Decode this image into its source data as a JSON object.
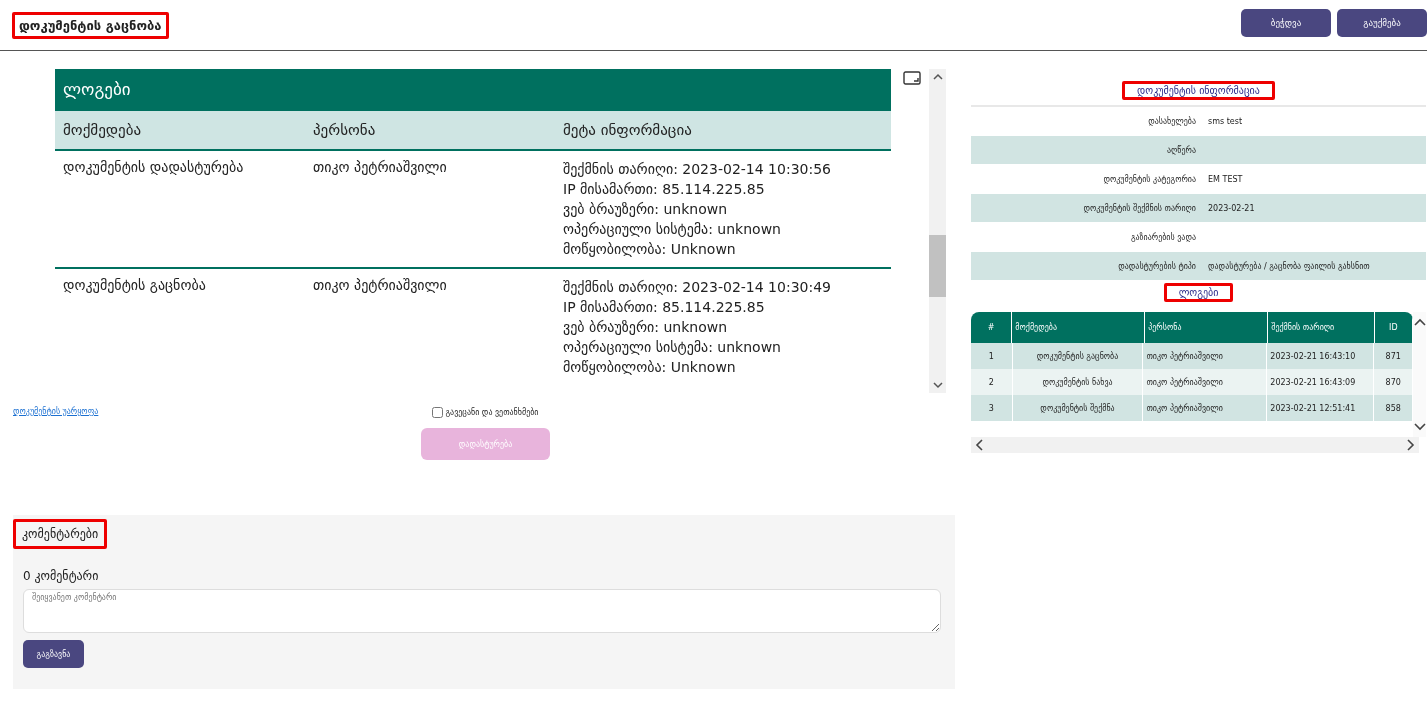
{
  "page_title": "დოკუმენტის გაცნობა",
  "header_buttons": [
    "ბეჭდვა",
    "გაუქმება"
  ],
  "document": {
    "heading": "ლოგები",
    "columns": [
      "მოქმედება",
      "პერსონა",
      "მეტა ინფორმაცია"
    ],
    "rows": [
      {
        "action": "დოკუმენტის დადასტურება",
        "person": "თიკო პეტრიაშვილი",
        "meta": [
          "შექმნის თარიღი: 2023-02-14 10:30:56",
          "IP მისამართი: 85.114.225.85",
          "ვებ ბრაუზერი: unknown",
          "ოპერაციული სისტემა: unknown",
          "მოწყობილობა: Unknown"
        ]
      },
      {
        "action": "დოკუმენტის გაცნობა",
        "person": "თიკო პეტრიაშვილი",
        "meta": [
          "შექმნის თარიღი: 2023-02-14 10:30:49",
          "IP მისამართი: 85.114.225.85",
          "ვებ ბრაუზერი: unknown",
          "ოპერაციული სისტემა: unknown",
          "მოწყობილობა: Unknown"
        ]
      }
    ]
  },
  "reject_link": "დოკუმენტის უარყოფა",
  "agree": {
    "label": "გავეცანი და ვეთანხმები",
    "checked": false
  },
  "confirm_button": {
    "label": "დადასტურება",
    "disabled": true
  },
  "comments": {
    "heading": "კომენტარები",
    "count": "0 კომენტარი",
    "placeholder": "შეიყვანეთ კომენტარი",
    "submit": "გაგზავნა"
  },
  "info": {
    "heading": "დოკუმენტის ინფორმაცია",
    "rows": [
      {
        "label": "დასახელება",
        "value": "sms test"
      },
      {
        "label": "აღწერა",
        "value": ""
      },
      {
        "label": "დოკუმენტის კატეგორია",
        "value": "EM TEST"
      },
      {
        "label": "დოკუმენტის შექმნის თარიღი",
        "value": "2023-02-21"
      },
      {
        "label": "გაზიარების ვადა",
        "value": ""
      },
      {
        "label": "დადასტურების ტიპი",
        "value": "დადასტურება / გაცნობა ფაილის გახსნით"
      }
    ]
  },
  "logs": {
    "heading": "ლოგები",
    "columns": [
      "#",
      "მოქმედება",
      "პერსონა",
      "შექმნის თარიღი",
      "ID"
    ],
    "rows": [
      [
        "1",
        "დოკუმენტის გაცნობა",
        "თიკო პეტრიაშვილი",
        "2023-02-21 16:43:10",
        "871"
      ],
      [
        "2",
        "დოკუმენტის ნახვა",
        "თიკო პეტრიაშვილი",
        "2023-02-21 16:43:09",
        "870"
      ],
      [
        "3",
        "დოკუმენტის შექმნა",
        "თიკო პეტრიაშვილი",
        "2023-02-21 12:51:41",
        "858"
      ]
    ]
  }
}
